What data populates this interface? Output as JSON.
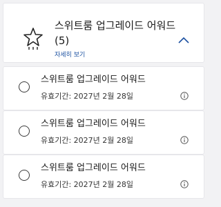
{
  "header": {
    "title": "스위트룸 업그레이드 어워드",
    "count": "(5)",
    "details_link": "자세히 보기",
    "collapse_icon": "chevron-up-icon",
    "award_icon": "star-icon"
  },
  "items": [
    {
      "title": "스위트룸 업그레이드 어워드",
      "validity": "유효기간: 2027년 2월 28일",
      "selected": false
    },
    {
      "title": "스위트룸 업그레이드 어워드",
      "validity": "유효기간: 2027년 2월 28일",
      "selected": false
    },
    {
      "title": "스위트룸 업그레이드 어워드",
      "validity": "유효기간: 2027년 2월 28일",
      "selected": false
    }
  ],
  "colors": {
    "link": "#1a4fa0",
    "chevron": "#1a4fa0",
    "background": "#f2f2f4"
  }
}
